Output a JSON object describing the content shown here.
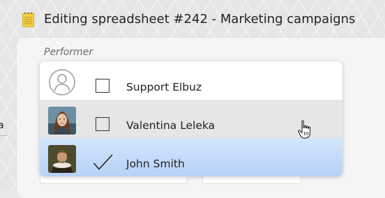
{
  "window": {
    "title": "Editing spreadsheet #242 - Marketing campaigns",
    "title_icon": "notepad-icon"
  },
  "left_edge_text": "a",
  "field": {
    "label": "Performer"
  },
  "dropdown": {
    "options": [
      {
        "name": "Support Elbuz",
        "checked": false,
        "avatar": "default-user-avatar",
        "state": "normal"
      },
      {
        "name": "Valentina Leleka",
        "checked": false,
        "avatar": "photo-avatar",
        "state": "hover"
      },
      {
        "name": "John Smith",
        "checked": true,
        "avatar": "portrait-painting-avatar",
        "state": "selected"
      }
    ]
  },
  "cursor": "hand-pointer-icon",
  "colors": {
    "hover_row": "#e6e6e6",
    "selected_row": "#c5dcfa",
    "panel_bg": "#f5f5f6"
  }
}
